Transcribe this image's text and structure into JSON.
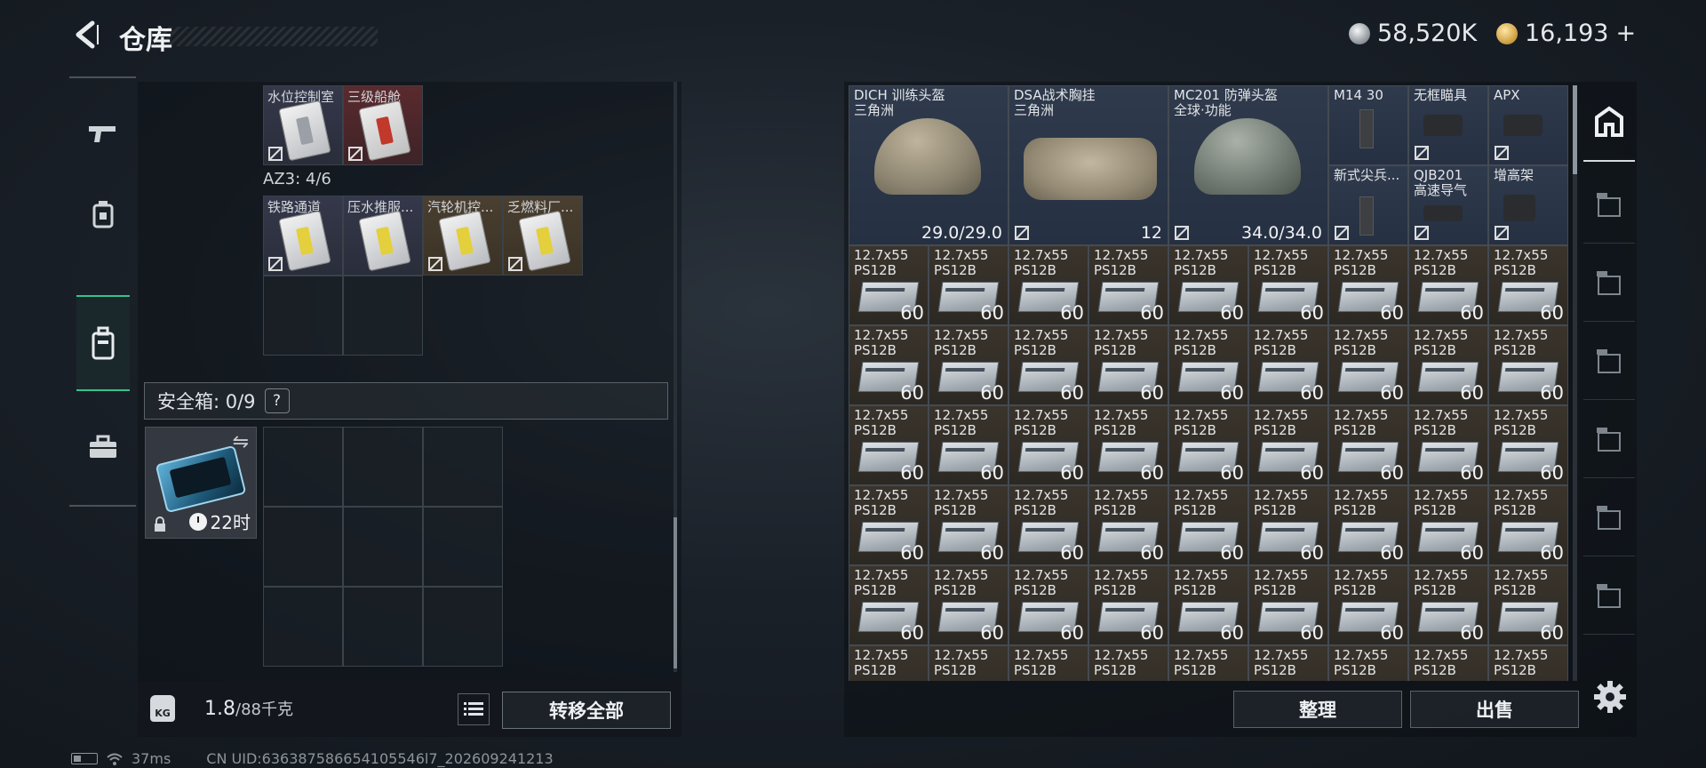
{
  "header": {
    "title": "仓库",
    "silver_amount": "58,520K",
    "gold_amount": "16,193",
    "gold_add": "+"
  },
  "leftnav": {
    "items": [
      {
        "name": "guns",
        "icon": "gun-icon"
      },
      {
        "name": "armor",
        "icon": "armor-icon"
      },
      {
        "name": "backpack",
        "icon": "backpack-icon",
        "active": true
      },
      {
        "name": "case",
        "icon": "briefcase-icon"
      }
    ]
  },
  "container": {
    "keycards_top": [
      "水位控制室",
      "三级船舱"
    ],
    "az3_label": "AZ3: 4/6",
    "keycards_mid": [
      "铁路通道",
      "压水推服...",
      "汽轮机控...",
      "乏燃料厂..."
    ],
    "safe_label": "安全箱: 0/9",
    "safe_help": "?",
    "safe_timer": "22时",
    "safe_swap": "⇋"
  },
  "footer_left": {
    "weight_icon": "KG",
    "weight": "1.8",
    "weight_max": "/88千克",
    "transfer_all": "转移全部"
  },
  "status": {
    "ping": "37ms",
    "uid": "CN UID:636387586654105546l7_202609241213"
  },
  "stash": {
    "gear": [
      {
        "name": "DICH 训练头盔",
        "sub": "三角洲",
        "dur": "29.0/29.0"
      },
      {
        "name": "DSA战术胸挂",
        "sub": "三角洲",
        "stack": "12"
      },
      {
        "name": "MC201 防弹头盔",
        "sub": "全球·功能",
        "dur": "34.0/34.0"
      },
      {
        "name": "M14 30"
      },
      {
        "name": "无框瞄具"
      },
      {
        "name": "APX"
      },
      {
        "name": "新式尖兵..."
      },
      {
        "name": "QJB201",
        "sub": "高速导气"
      },
      {
        "name": "增高架"
      }
    ],
    "ammo_label": "12.7x55",
    "ammo_sub": "PS12B",
    "ammo_qty": "60"
  },
  "footer_right": {
    "sort": "整理",
    "sell": "出售"
  },
  "side_tabs": [
    "home-icon",
    "tier4-icon",
    "gti-icon",
    "v-icon",
    "v2-icon",
    "g-icon",
    "gt-icon"
  ]
}
